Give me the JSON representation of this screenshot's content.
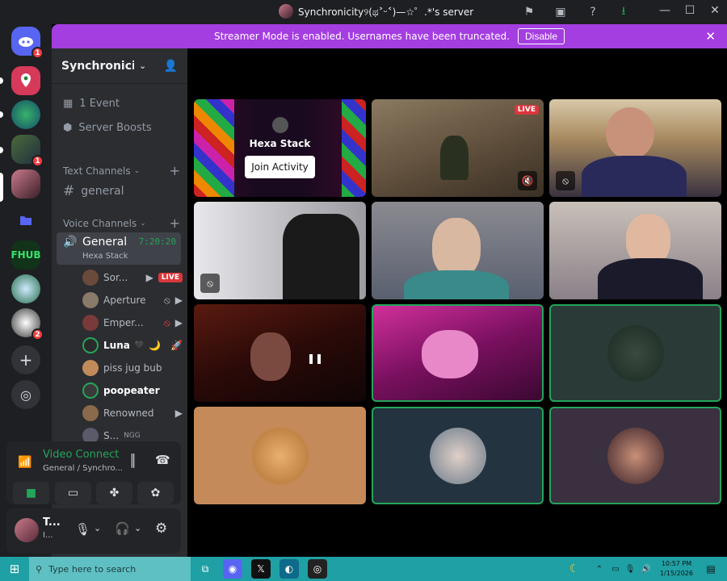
{
  "window": {
    "title": "Synchronicity୨(ಥ˃ᵕ˂)—☆゜.*'s server"
  },
  "banner": {
    "text": "Streamer Mode is enabled. Usernames have been truncated.",
    "button": "Disable"
  },
  "guilds": {
    "badges": [
      "1",
      "1",
      "2"
    ]
  },
  "server": {
    "name": "Synchronici..."
  },
  "sidebar": {
    "event": "1 Event",
    "boosts": "Server Boosts",
    "text_category": "Text Channels",
    "text_channel": "general",
    "voice_category": "Voice Channels",
    "voice_channel": "General",
    "voice_timer": "7:20:20",
    "voice_activity": "Hexa Stack",
    "live": "LIVE",
    "members": [
      "Sor...",
      "Aperture",
      "Emper...",
      "Luna",
      "piss jug bub",
      "poopeater",
      "Renowned",
      "S..."
    ],
    "ngg": "NGG"
  },
  "voice_panel": {
    "status": "Video Connecte",
    "location": "General / Synchro..."
  },
  "user": {
    "name": "T...",
    "status": "I..."
  },
  "stage": {
    "activity_title": "Hexa Stack",
    "activity_button": "Join Activity",
    "live": "LIVE"
  },
  "taskbar": {
    "search_placeholder": "Type here to search",
    "time": "10:57 PM",
    "date": "1/15/2026"
  },
  "colors": {
    "accent": "#a43ee0",
    "speaking": "#23a55a",
    "live": "#da373c",
    "taskbar": "#1ea0a5"
  }
}
